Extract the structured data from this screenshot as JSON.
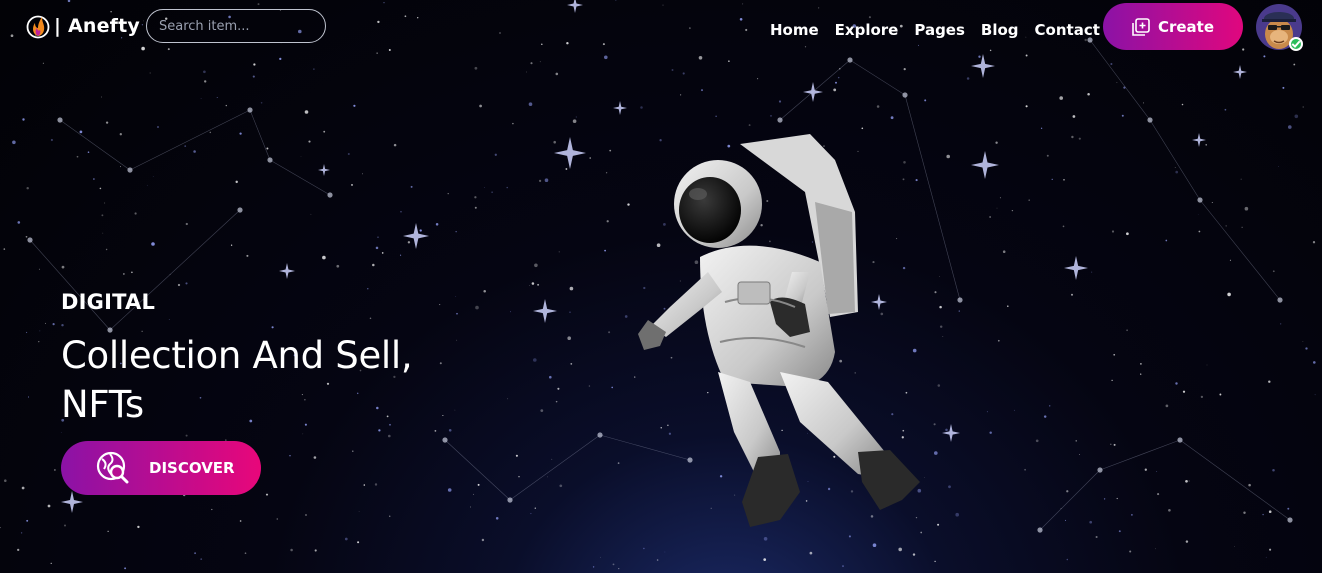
{
  "brand": {
    "name": "| Anefty",
    "logo_icon": "flame-logo-icon"
  },
  "search": {
    "placeholder": "Search item...",
    "value": ""
  },
  "nav": {
    "links": [
      "Home",
      "Explore",
      "Pages",
      "Blog",
      "Contact"
    ]
  },
  "actions": {
    "create_label": "Create",
    "create_icon": "add-square-icon",
    "avatar_icon": "ape-avatar-icon",
    "verified_icon": "check-icon"
  },
  "hero": {
    "eyebrow": "DIGITAL",
    "headline_line1": "Collection And Sell,",
    "headline_line2": "NFTs",
    "discover_label": "DISCOVER",
    "discover_icon": "globe-search-icon",
    "image": "astronaut-illustration"
  },
  "colors": {
    "gradient_start": "#8b12a6",
    "gradient_end": "#e0077e",
    "background": "#050512",
    "text": "#ffffff"
  }
}
